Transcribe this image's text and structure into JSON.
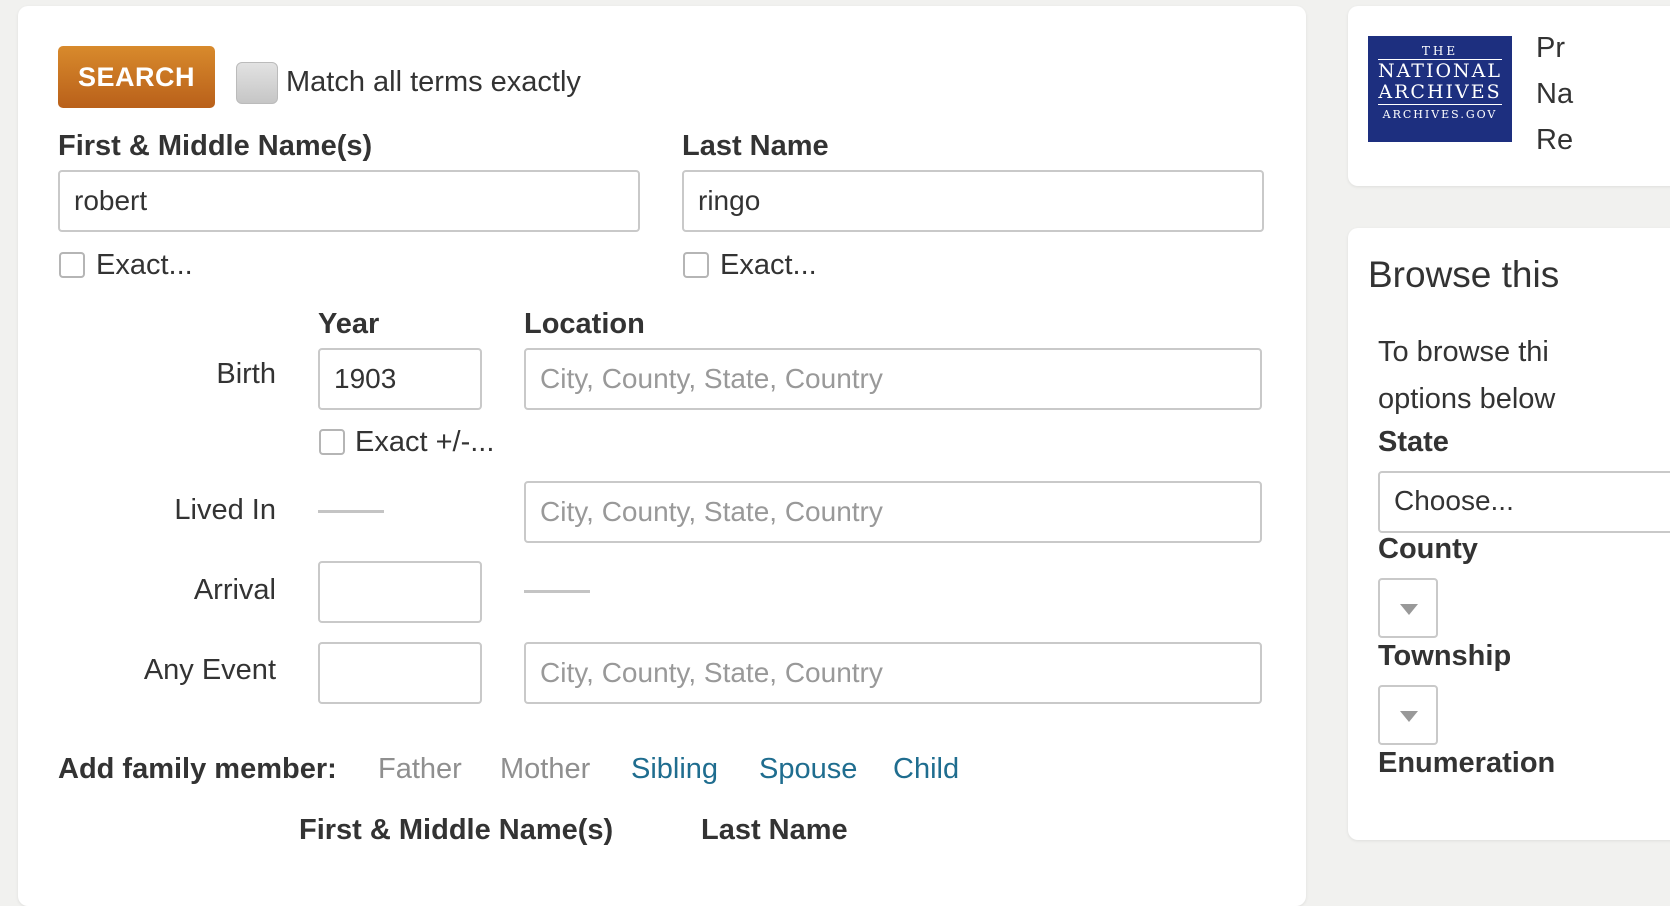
{
  "search": {
    "button_label": "SEARCH",
    "match_exact_label": "Match all terms exactly",
    "first_name": {
      "label": "First & Middle Name(s)",
      "value": "robert",
      "exact_label": "Exact..."
    },
    "last_name": {
      "label": "Last Name",
      "value": "ringo",
      "exact_label": "Exact..."
    },
    "year_header": "Year",
    "location_header": "Location",
    "birth": {
      "label": "Birth",
      "year": "1903",
      "location_placeholder": "City, County, State, Country",
      "exact_label": "Exact +/-..."
    },
    "lived_in": {
      "label": "Lived In",
      "location_placeholder": "City, County, State, Country"
    },
    "arrival": {
      "label": "Arrival",
      "year": ""
    },
    "any_event": {
      "label": "Any Event",
      "year": "",
      "location_placeholder": "City, County, State, Country"
    },
    "family": {
      "label": "Add family member:",
      "links": [
        "Father",
        "Mother",
        "Sibling",
        "Spouse",
        "Child"
      ],
      "active": [
        false,
        false,
        true,
        true,
        true
      ],
      "first_header": "First & Middle Name(s)",
      "last_header": "Last Name"
    }
  },
  "logo_card": {
    "logo_lines": [
      "THE",
      "NATIONAL",
      "ARCHIVES",
      "ARCHIVES.GOV"
    ],
    "text_lines": [
      "Pr",
      "Na",
      "Re"
    ]
  },
  "browse": {
    "title": "Browse this",
    "desc_lines": [
      "To browse thi",
      "options below"
    ],
    "state_label": "State",
    "state_value": "Choose...",
    "county_label": "County",
    "township_label": "Township",
    "enumeration_label": "Enumeration"
  },
  "colors": {
    "search_button": "#c9731f",
    "link_active": "#1f6d8f",
    "link_inactive": "#8f8f8f",
    "logo_bg": "#1d2f7f"
  }
}
